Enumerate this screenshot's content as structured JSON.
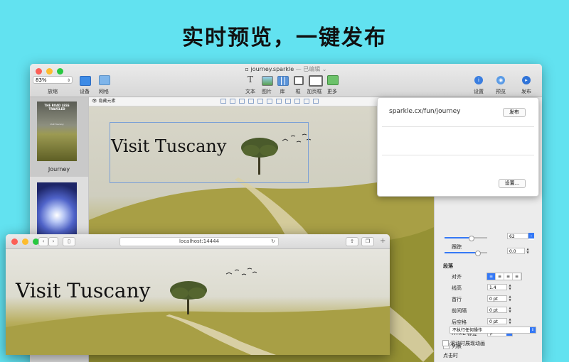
{
  "headline": "实时预览，一键发布",
  "editor": {
    "title": "journey.sparkle",
    "edited": "— 已编辑 ⌄",
    "zoom": "83%",
    "toolbar_left": {
      "zoom_label": "放缩",
      "device": "设备",
      "grid": "网格"
    },
    "toolbar_center": [
      {
        "label": "文本"
      },
      {
        "label": "图片"
      },
      {
        "label": "库"
      },
      {
        "label": "框"
      },
      {
        "label": "加页框"
      },
      {
        "label": "更多"
      }
    ],
    "toolbar_right": [
      {
        "label": "设置"
      },
      {
        "label": "预览"
      },
      {
        "label": "发布"
      }
    ],
    "hide_elements": "隐藏元素",
    "pages": [
      {
        "label": "Journey",
        "thumb_title": "THE ROAD LESS TRAVELED",
        "thumb_sub": "Visit Tuscany"
      },
      {
        "label": ""
      }
    ],
    "canvas_title": "Visit Tuscany"
  },
  "panel": {
    "size_value": "62",
    "tracking_label": "跟踪",
    "tracking_value": "0.0",
    "paragraph_heading": "段落",
    "align_label": "对齐",
    "line_height_label": "线高",
    "line_height_value": "1.4",
    "first_line_label": "首行",
    "first_line_value": "0 pt",
    "space_before_label": "前间隔",
    "space_before_value": "0 pt",
    "space_after_label": "后空格",
    "space_after_value": "0 pt",
    "html_tag_label": "HTML 标签",
    "html_tag_value": "p",
    "list_label": "列表",
    "on_click_heading": "点击时",
    "on_click_value": "不执行任何操作",
    "scroll_anim_label": "滚动时展现动画"
  },
  "popover": {
    "url": "sparkle.cx/fun/journey",
    "publish_button": "发布",
    "settings_button": "设置..."
  },
  "browser": {
    "url": "localhost:14444",
    "site_title": "Visit Tuscany"
  },
  "colors": {
    "accent": "#3478f6",
    "background": "#62e2f0"
  }
}
